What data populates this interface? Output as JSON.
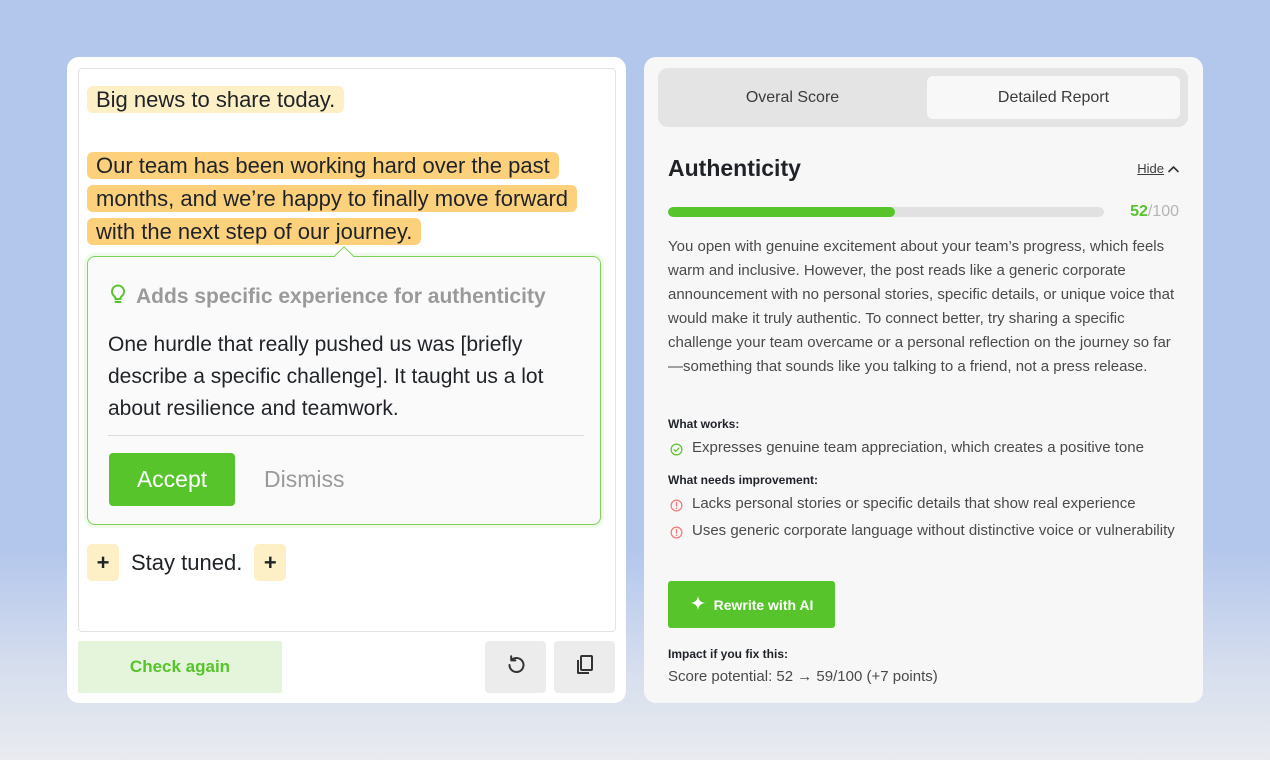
{
  "editor": {
    "paragraph1": "Big news to share today.",
    "paragraph2": "Our team has been working hard over the past months, and we’re happy to finally move forward with the next step of our journey.",
    "closing": "Stay tuned.",
    "plus_label": "+"
  },
  "suggestion": {
    "title": "Adds specific experience for authenticity",
    "body": "One hurdle that really pushed us was [briefly describe a specific challenge]. It taught us a lot about resilience and teamwork.",
    "accept_label": "Accept",
    "dismiss_label": "Dismiss"
  },
  "footer": {
    "check_again_label": "Check again"
  },
  "tabs": {
    "overall_label": "Overal Score",
    "detailed_label": "Detailed Report"
  },
  "report": {
    "title": "Authenticity",
    "hide_label": "Hide",
    "score": 52,
    "score_max": "/100",
    "progress_fraction": 0.52,
    "description": "You open with genuine excitement about your team’s progress, which feels warm and inclusive. However, the post reads like a generic corporate announcement with no personal stories, specific details, or unique voice that would make it truly authentic. To connect better, try sharing a specific challenge your team overcame or a personal reflection on the journey so far—something that sounds like you talking to a friend, not a press release.",
    "works_heading": "What works:",
    "works": [
      "Expresses genuine team appreciation, which creates a positive tone"
    ],
    "improve_heading": "What needs improvement:",
    "improvements": [
      "Lacks personal stories or specific details that show real experience",
      "Uses generic corporate language without distinctive voice or vulnerability"
    ],
    "rewrite_label": "Rewrite with AI",
    "impact_heading": "Impact if you fix this:",
    "impact_text": "Score potential: 52 → 59/100 (+7 points)"
  },
  "colors": {
    "accent_green": "#56c42a",
    "highlight_light": "#fdefc6",
    "highlight_strong": "#fdd17c",
    "warning_red": "#f07878"
  }
}
